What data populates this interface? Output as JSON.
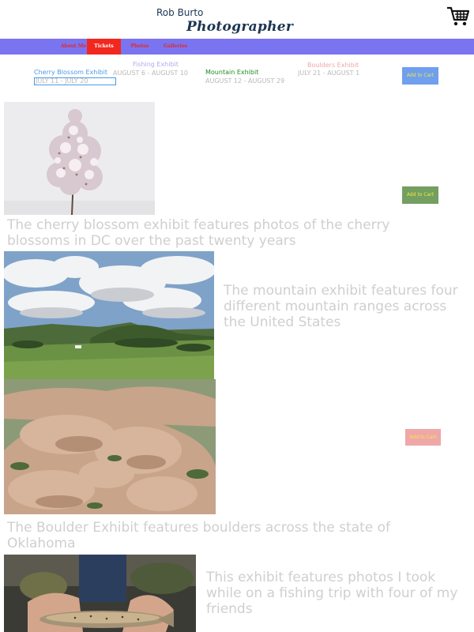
{
  "header": {
    "name": "Rob Burto",
    "script_title": "Photographer",
    "cart_icon": "shopping-cart-icon"
  },
  "nav": {
    "items": [
      {
        "label": "About Me"
      },
      {
        "label": "Tickets"
      },
      {
        "label": "Photos"
      },
      {
        "label": "Galleries"
      }
    ],
    "bar_color": "#7b74f0",
    "active_color": "#f2271f"
  },
  "exhibits": [
    {
      "name": "Cherry Blossom Exhibit",
      "dates": "JULY 11 - JULY 20",
      "color": "#4b9ae4"
    },
    {
      "name": "Fishing Exhibit",
      "dates": "AUGUST 6 - AUGUST 10",
      "color": "#b3a9e6"
    },
    {
      "name": "Mountain Exhibit",
      "dates": "AUGUST 12 - AUGUST 29",
      "color": "#1f8b1f"
    },
    {
      "name": "Boulders Exhibit",
      "dates": "JULY 21 - AUGUST 1",
      "color": "#f0a7a7"
    }
  ],
  "buttons": {
    "add1": "Add to Cart",
    "add2": "Add to Cart",
    "add3": "Add to Cart"
  },
  "sections": {
    "cherry": "The cherry blossom exhibit features photos of the cherry blossoms in DC over the past twenty years",
    "mountain": "The mountain exhibit features four different mountain ranges across the United States",
    "boulder": "The Boulder Exhibit features boulders across the state of Oklahoma",
    "fishing": "This exhibit features photos I took while on a fishing trip with four of my friends"
  }
}
